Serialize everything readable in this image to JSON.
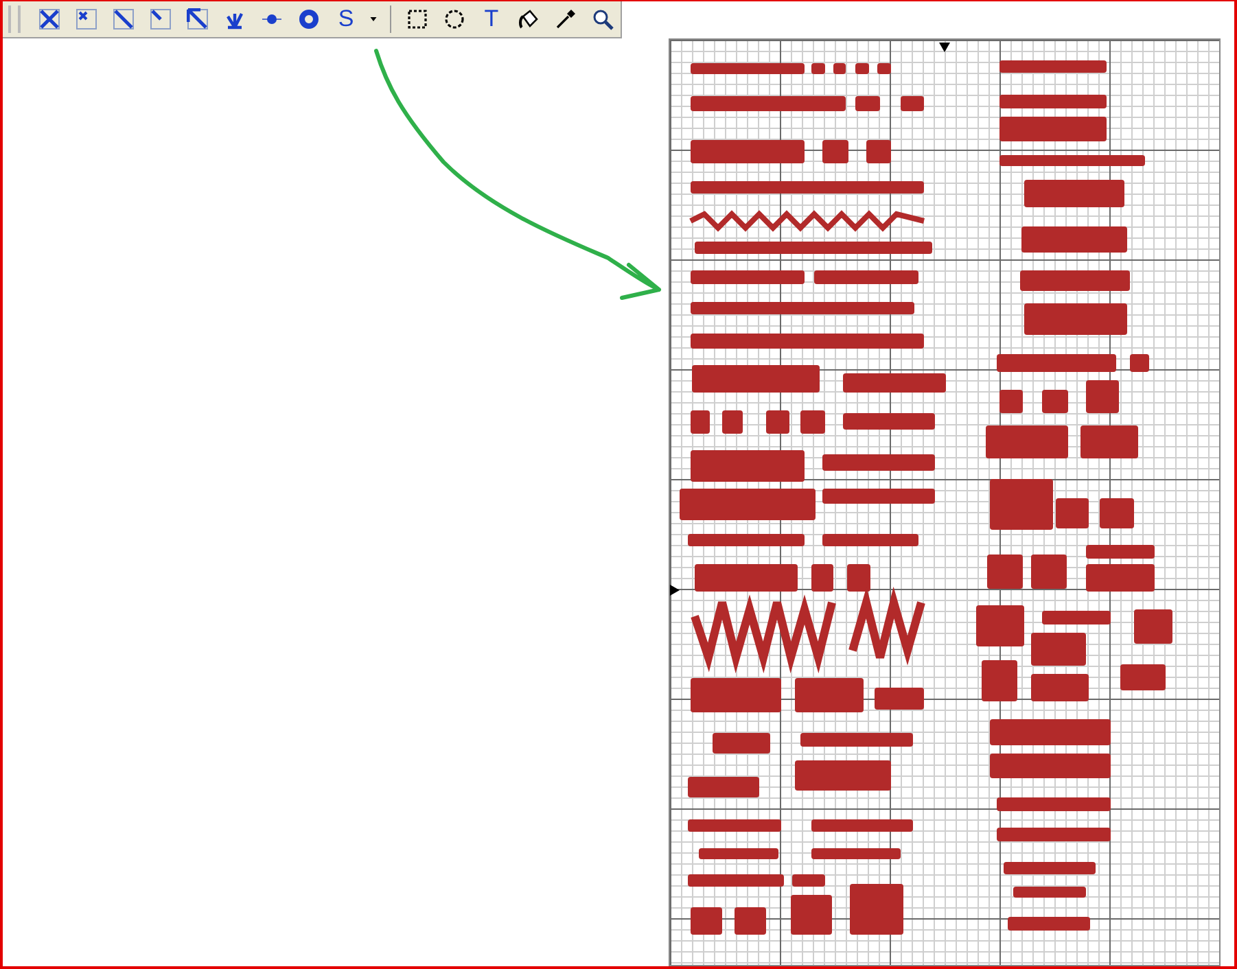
{
  "toolbar": {
    "tools": [
      {
        "kind": "full-cross"
      },
      {
        "kind": "petite-cross"
      },
      {
        "kind": "half-stitch"
      },
      {
        "kind": "quarter-stitch"
      },
      {
        "kind": "three-quarter"
      },
      {
        "kind": "fan"
      },
      {
        "kind": "knot"
      },
      {
        "kind": "bead"
      },
      {
        "kind": "letter",
        "label": "S"
      },
      {
        "kind": "dropdown"
      },
      {
        "kind": "separator"
      },
      {
        "kind": "rect-select"
      },
      {
        "kind": "ellipse-select"
      },
      {
        "kind": "letter",
        "label": "T"
      },
      {
        "kind": "fill"
      },
      {
        "kind": "eyedropper"
      },
      {
        "kind": "zoom"
      }
    ]
  }
}
